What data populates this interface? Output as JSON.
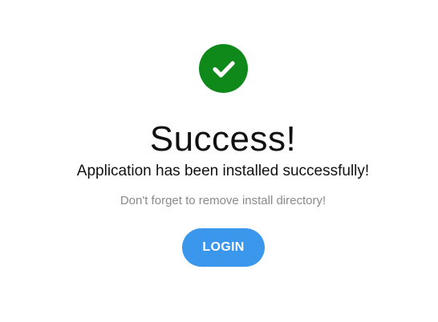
{
  "status": {
    "icon": "checkmark-circle-icon",
    "icon_color": "#0f8a1a",
    "title": "Success!",
    "message": "Application has been installed successfully!",
    "note": "Don't forget to remove install directory!"
  },
  "actions": {
    "login_label": "LOGIN",
    "login_color": "#3a97ec"
  }
}
